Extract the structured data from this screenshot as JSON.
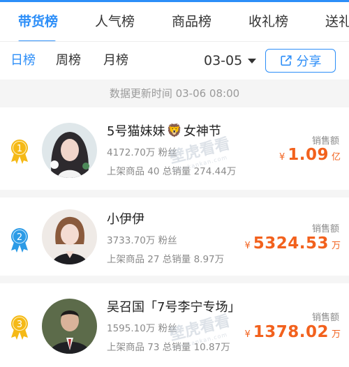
{
  "tabs": [
    {
      "label": "带货榜"
    },
    {
      "label": "人气榜"
    },
    {
      "label": "商品榜"
    },
    {
      "label": "收礼榜"
    },
    {
      "label": "送礼"
    }
  ],
  "periods": [
    {
      "label": "日榜"
    },
    {
      "label": "周榜"
    },
    {
      "label": "月榜"
    }
  ],
  "date": "03-05",
  "share_label": "分享",
  "update_text": "数据更新时间 03-06 08:00",
  "watermark": {
    "text": "壁虎看看",
    "sub": "bihukankan.com"
  },
  "colors": {
    "accent": "#2c8ef8",
    "sales": "#f2611d",
    "gold": "#f5b916",
    "blue": "#2c9be6"
  },
  "ranking": [
    {
      "rank": "1",
      "name_prefix": "5号猫妹妹",
      "name_emoji": "🦁",
      "name_suffix": "女神节",
      "fans": "4172.70万 粉丝",
      "listed_label": "上架商品",
      "listed": "40",
      "total_label": "总销量",
      "total": "274.44万",
      "sales_label": "销售额",
      "currency": "¥",
      "sales": "1.09",
      "unit": "亿"
    },
    {
      "rank": "2",
      "name_prefix": "小伊伊",
      "name_emoji": "",
      "name_suffix": "",
      "fans": "3733.70万 粉丝",
      "listed_label": "上架商品",
      "listed": "27",
      "total_label": "总销量",
      "total": "8.97万",
      "sales_label": "销售额",
      "currency": "¥",
      "sales": "5324.53",
      "unit": "万"
    },
    {
      "rank": "3",
      "name_prefix": "吴召国「7号李宁专场」",
      "name_emoji": "",
      "name_suffix": "",
      "fans": "1595.10万 粉丝",
      "listed_label": "上架商品",
      "listed": "73",
      "total_label": "总销量",
      "total": "10.87万",
      "sales_label": "销售额",
      "currency": "¥",
      "sales": "1378.02",
      "unit": "万"
    }
  ]
}
